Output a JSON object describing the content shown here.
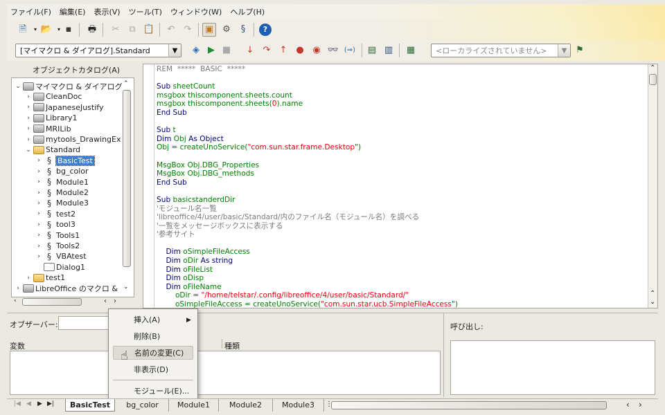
{
  "menu": [
    "ファイル(F)",
    "編集(E)",
    "表示(V)",
    "ツール(T)",
    "ウィンドウ(W)",
    "ヘルプ(H)"
  ],
  "toolbar": {
    "library_combo": "[マイマクロ & ダイアログ].Standard",
    "language_combo_placeholder": "<ローカライズされていません>"
  },
  "catalog": {
    "title": "オブジェクトカタログ(A)",
    "tree": [
      {
        "label": "マイマクロ & ダイアログ",
        "type": "lib",
        "depth": 0,
        "twisty": "v"
      },
      {
        "label": "CleanDoc",
        "type": "lib",
        "depth": 1,
        "twisty": ">"
      },
      {
        "label": "JapaneseJustify",
        "type": "lib",
        "depth": 1,
        "twisty": ">"
      },
      {
        "label": "Library1",
        "type": "lib",
        "depth": 1,
        "twisty": ">"
      },
      {
        "label": "MRILib",
        "type": "lib",
        "depth": 1,
        "twisty": ">"
      },
      {
        "label": "mytools_DrawingEx",
        "type": "lib",
        "depth": 1,
        "twisty": ">"
      },
      {
        "label": "Standard",
        "type": "fold",
        "depth": 1,
        "twisty": "v"
      },
      {
        "label": "BasicTest",
        "type": "mod",
        "depth": 2,
        "twisty": ">",
        "selected": true
      },
      {
        "label": "bg_color",
        "type": "mod",
        "depth": 2,
        "twisty": ">"
      },
      {
        "label": "Module1",
        "type": "mod",
        "depth": 2,
        "twisty": ">"
      },
      {
        "label": "Module2",
        "type": "mod",
        "depth": 2,
        "twisty": ">"
      },
      {
        "label": "Module3",
        "type": "mod",
        "depth": 2,
        "twisty": ">"
      },
      {
        "label": "test2",
        "type": "mod",
        "depth": 2,
        "twisty": ">"
      },
      {
        "label": "tool3",
        "type": "mod",
        "depth": 2,
        "twisty": ">"
      },
      {
        "label": "Tools1",
        "type": "mod",
        "depth": 2,
        "twisty": ">"
      },
      {
        "label": "Tools2",
        "type": "mod",
        "depth": 2,
        "twisty": ">"
      },
      {
        "label": "VBAtest",
        "type": "mod",
        "depth": 2,
        "twisty": ">"
      },
      {
        "label": "Dialog1",
        "type": "dlg",
        "depth": 2,
        "twisty": ""
      },
      {
        "label": "test1",
        "type": "fold",
        "depth": 1,
        "twisty": ">"
      },
      {
        "label": "LibreOffice のマクロ &",
        "type": "lib",
        "depth": 0,
        "twisty": ">"
      }
    ]
  },
  "code_lines": [
    [
      [
        "c",
        "REM  *****  BASIC  *****"
      ]
    ],
    [],
    [
      [
        "k",
        "Sub "
      ],
      [
        "g",
        "sheetCount"
      ]
    ],
    [
      [
        "g",
        "msgbox thiscomponent.sheets.count"
      ]
    ],
    [
      [
        "g",
        "msgbox thiscomponent.sheets("
      ],
      [
        "n",
        "0"
      ],
      [
        "g",
        ").name"
      ]
    ],
    [
      [
        "k",
        "End Sub"
      ]
    ],
    [],
    [
      [
        "k",
        "Sub "
      ],
      [
        "g",
        "t"
      ]
    ],
    [
      [
        "k",
        "Dim "
      ],
      [
        "g",
        "Obj "
      ],
      [
        "k",
        "As Object"
      ]
    ],
    [
      [
        "g",
        "Obj = createUnoService("
      ],
      [
        "s",
        "\"com.sun.star.frame.Desktop\""
      ],
      [
        "g",
        ")"
      ]
    ],
    [],
    [
      [
        "g",
        "MsgBox Obj.DBG_Properties"
      ]
    ],
    [
      [
        "g",
        "MsgBox Obj.DBG_methods"
      ]
    ],
    [
      [
        "k",
        "End Sub"
      ]
    ],
    [],
    [
      [
        "k",
        "Sub "
      ],
      [
        "g",
        "basicstanderdDir"
      ]
    ],
    [
      [
        "c",
        "'モジュール名一覧"
      ]
    ],
    [
      [
        "c",
        "'libreoffice/4/user/basic/Standard/内のファイル名（モジュール名）を調べる"
      ]
    ],
    [
      [
        "c",
        "'一覧をメッセージボックスに表示する"
      ]
    ],
    [
      [
        "c",
        "'参考サイト"
      ]
    ],
    [],
    [
      [
        "k",
        "    Dim "
      ],
      [
        "g",
        "oSimpleFileAccess"
      ]
    ],
    [
      [
        "k",
        "    Dim "
      ],
      [
        "g",
        "oDir "
      ],
      [
        "k",
        "As string"
      ]
    ],
    [
      [
        "k",
        "    Dim "
      ],
      [
        "g",
        "oFileList"
      ]
    ],
    [
      [
        "k",
        "    Dim "
      ],
      [
        "g",
        "oDisp"
      ]
    ],
    [
      [
        "k",
        "    Dim "
      ],
      [
        "g",
        "oFileName"
      ]
    ],
    [
      [
        "g",
        "        oDir = "
      ],
      [
        "s",
        "\"/home/telstar/.config/libreoffice/4/user/basic/Standard/\""
      ]
    ],
    [
      [
        "g",
        "        oSimpleFileAccess = createUnoService("
      ],
      [
        "s",
        "\"com.sun.star.ucb.SimpleFileAccess\""
      ],
      [
        "g",
        ")"
      ]
    ]
  ],
  "watch": {
    "label": "オブザーバー:",
    "col_variable": "変数",
    "col_type": "種類"
  },
  "calls": {
    "label": "呼び出し:"
  },
  "context_menu": [
    {
      "label": "挿入(A)",
      "submenu": true
    },
    {
      "label": "削除(B)"
    },
    {
      "label": "名前の変更(C)",
      "highlight": true
    },
    {
      "label": "非表示(D)"
    },
    {
      "label": "モジュール(E)..."
    }
  ],
  "tabs": [
    "BasicTest",
    "bg_color",
    "Module1",
    "Module2",
    "Module3"
  ],
  "colors": {
    "comment": "#7a7a7a",
    "keyword": "#00007c",
    "identifier": "#008000",
    "string": "#e8000a",
    "number": "#ff0000",
    "selection": "#3e7fd6"
  },
  "icons": [
    "new-document-icon",
    "open-icon",
    "save-icon",
    "print-icon",
    "cut-icon",
    "copy-icon",
    "paste-icon",
    "undo-icon",
    "redo-icon",
    "basic-ide-icon",
    "macro-settings-icon",
    "basic-macros-icon",
    "help-icon"
  ]
}
